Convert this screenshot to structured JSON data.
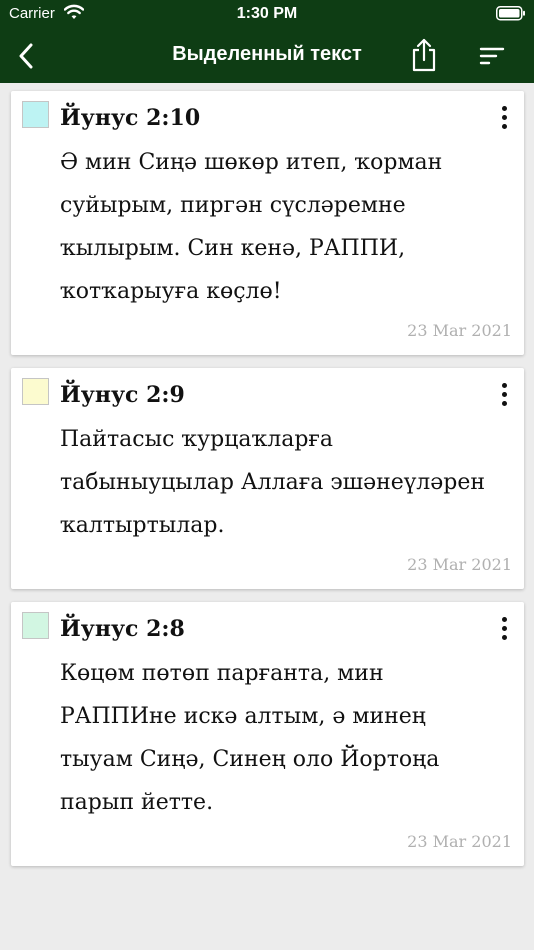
{
  "status_bar": {
    "carrier": "Carrier",
    "time": "1:30 PM"
  },
  "nav": {
    "title": "Выделенный текст"
  },
  "highlights": [
    {
      "ref": "Йунус 2:10",
      "text": "Ә мин Сиңә шөкөр итеп, ҡорман суйырым, пиргән сүсләремне ҡылырым. Син кенә, РАППИ, ҡотҡарыуға көҫлө!",
      "date": "23 Mar 2021",
      "color": "#bdf3f3"
    },
    {
      "ref": "Йунус 2:9",
      "text": "Пайтасыс ҡурцаҡларға табыныуцылар Аллаға эшәнеүләрен ҡалтыртылар.",
      "date": "23 Mar 2021",
      "color": "#fcfbcf"
    },
    {
      "ref": "Йунус 2:8",
      "text": "Көцөм пөтөп парғанта, мин РАППИне искә алтым, ә минең тыуам Сиңә, Синең оло Йортоңа парып йетте.",
      "date": "23 Mar 2021",
      "color": "#d2f6e2"
    }
  ]
}
